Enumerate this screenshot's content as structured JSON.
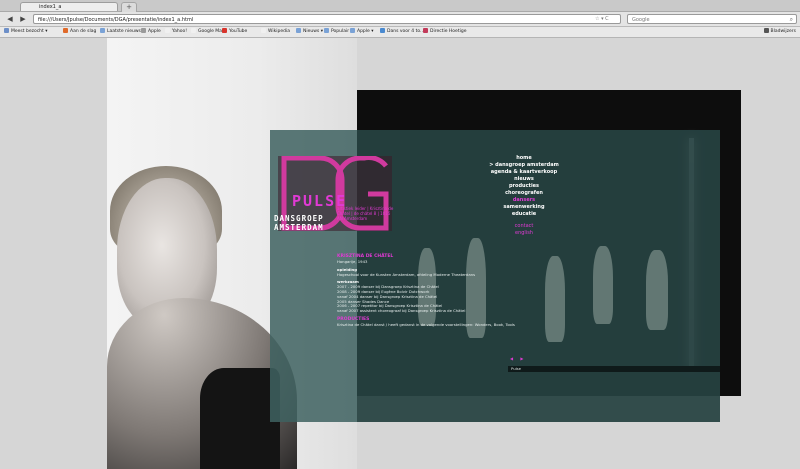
{
  "browser": {
    "tab_title": "index1_a",
    "new_tab": "+",
    "back": "◀",
    "forward": "▶",
    "url": "file:///Users/Jpulse/Documents/DGA/presentatie/index1_a.html",
    "url_controls": "☆ ▾ C",
    "search_placeholder": "Google",
    "bookmarks": [
      {
        "label": "Meest bezocht ▾",
        "color": "#6d8fc8"
      },
      {
        "label": "Aan de slag",
        "color": "#e06a2a"
      },
      {
        "label": "Laatste nieuws ▾",
        "color": "#7aa2d6"
      },
      {
        "label": "Apple",
        "color": "#9a9a9a"
      },
      {
        "label": "Yahoo!",
        "color": "#f0f0f0"
      },
      {
        "label": "Google Maps",
        "color": "#f0f0f0"
      },
      {
        "label": "YouTube",
        "color": "#d8342c"
      },
      {
        "label": "Wikipedia",
        "color": "#f0f0f0"
      },
      {
        "label": "Nieuws ▾",
        "color": "#7aa2d6"
      },
      {
        "label": "Populair ▾",
        "color": "#7aa2d6"
      },
      {
        "label": "Apple ▾",
        "color": "#7aa2d6"
      },
      {
        "label": "Dans voor 4 to...",
        "color": "#4a8ad0"
      },
      {
        "label": "Directie Hoetige",
        "color": "#c23a5a"
      }
    ],
    "bookmarks_right": "Bladwijzers"
  },
  "site": {
    "logo_big": "DG",
    "logo_word": "PULSE",
    "logo_line1": "DANSGROEP",
    "logo_line2": "AMSTERDAM",
    "logo_tagline": "krisztina de châtel",
    "logo_info": "artistiek leider | Krisztina de Châtel | de châtel 8 | 1016 AN Amsterdam",
    "nav": [
      {
        "label": "home",
        "active": false
      },
      {
        "label": "> dansgroep amsterdam",
        "active": false
      },
      {
        "label": "agenda & kaartverkoop",
        "active": false
      },
      {
        "label": "nieuws",
        "active": false
      },
      {
        "label": "producties",
        "active": false
      },
      {
        "label": "choreografen",
        "active": false
      },
      {
        "label": "dansers",
        "active": true
      },
      {
        "label": "samenwerking",
        "active": false
      },
      {
        "label": "educatie",
        "active": false
      }
    ],
    "nav_sub": [
      "contact",
      "english"
    ],
    "content": {
      "name": "KRISZTINA DE CHÂTEL",
      "born": "Hongarije, 1943",
      "opleiding_title": "opleiding",
      "opleiding": "Hogeschool voor de Kunsten Amsterdam, afdeling Moderne Theaterdans",
      "werkzaam_title": "werkzaam",
      "werkzaam": [
        "2007 - 2009 danser bij Dansgroep Krisztina de Châtel",
        "2008 - 2009 danser bij Eugène Bolvir Dutchwork",
        "vanaf 2004 danser bij Dansgroep Krisztina de Châtel",
        "2005 danser Shades Dance",
        "2006 - 2007 repetitor bij Dansgroep Krisztina de Châtel",
        "vanaf 2007 assistent choreograaf bij Dansgroep Krisztina de Châtel"
      ],
      "producties_title": "PRODUCTIES",
      "producties": "Krisztina de Châtel danst / heeft gedanst in de volgende voorstellingen: Wonders, Book, Tools"
    },
    "mini_controls": "◀ ▶",
    "ticker": "Pulse"
  }
}
